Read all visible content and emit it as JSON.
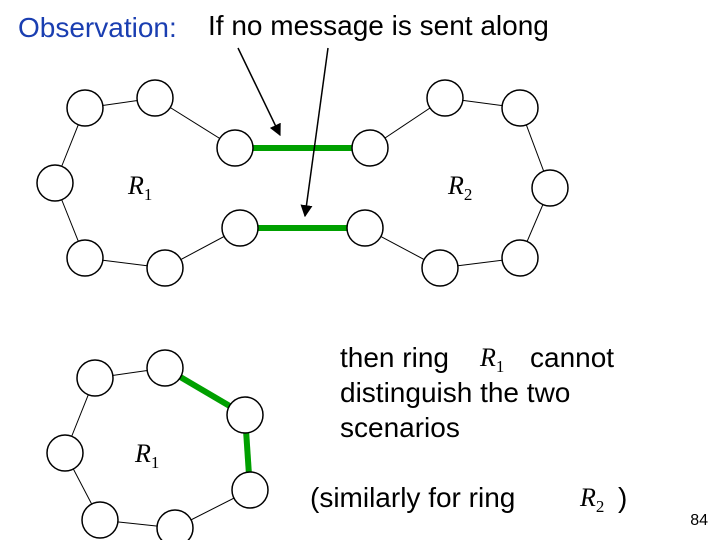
{
  "header": {
    "observation_label": "Observation:",
    "observation_text": "If no message is sent along"
  },
  "rings": {
    "r1_big": "R",
    "r1_big_sub": "1",
    "r2_big": "R",
    "r2_big_sub": "2",
    "r1_small": "R",
    "r1_small_sub": "1"
  },
  "body": {
    "line1a": "then ring",
    "line1_ring": "R",
    "line1_ring_sub": "1",
    "line1b": "cannot",
    "line2": "distinguish the two",
    "line3": "scenarios",
    "paren_a": "(similarly for ring",
    "paren_ring": "R",
    "paren_ring_sub": "2",
    "paren_b": ")"
  },
  "page": "84"
}
